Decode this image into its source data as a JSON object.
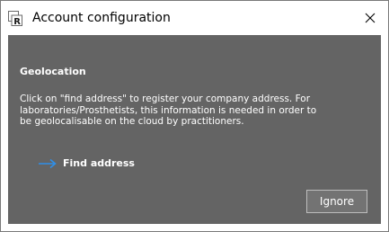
{
  "window": {
    "title": "Account configuration"
  },
  "geolocation": {
    "heading": "Geolocation",
    "description_lines": [
      "Click on \"find address\" to register your company address. For",
      "laboratories/Prosthetists, this information is needed in order to",
      "be geolocalisable on the cloud by practitioners."
    ],
    "find_address_label": "Find address"
  },
  "buttons": {
    "ignore_label": "Ignore"
  },
  "icons": {
    "app": "app-r-icon",
    "close": "close-icon",
    "find": "arrow-right-icon"
  },
  "colors": {
    "panel": "#646464",
    "accent_arrow": "#2f8fe8",
    "text": "#ffffff"
  }
}
